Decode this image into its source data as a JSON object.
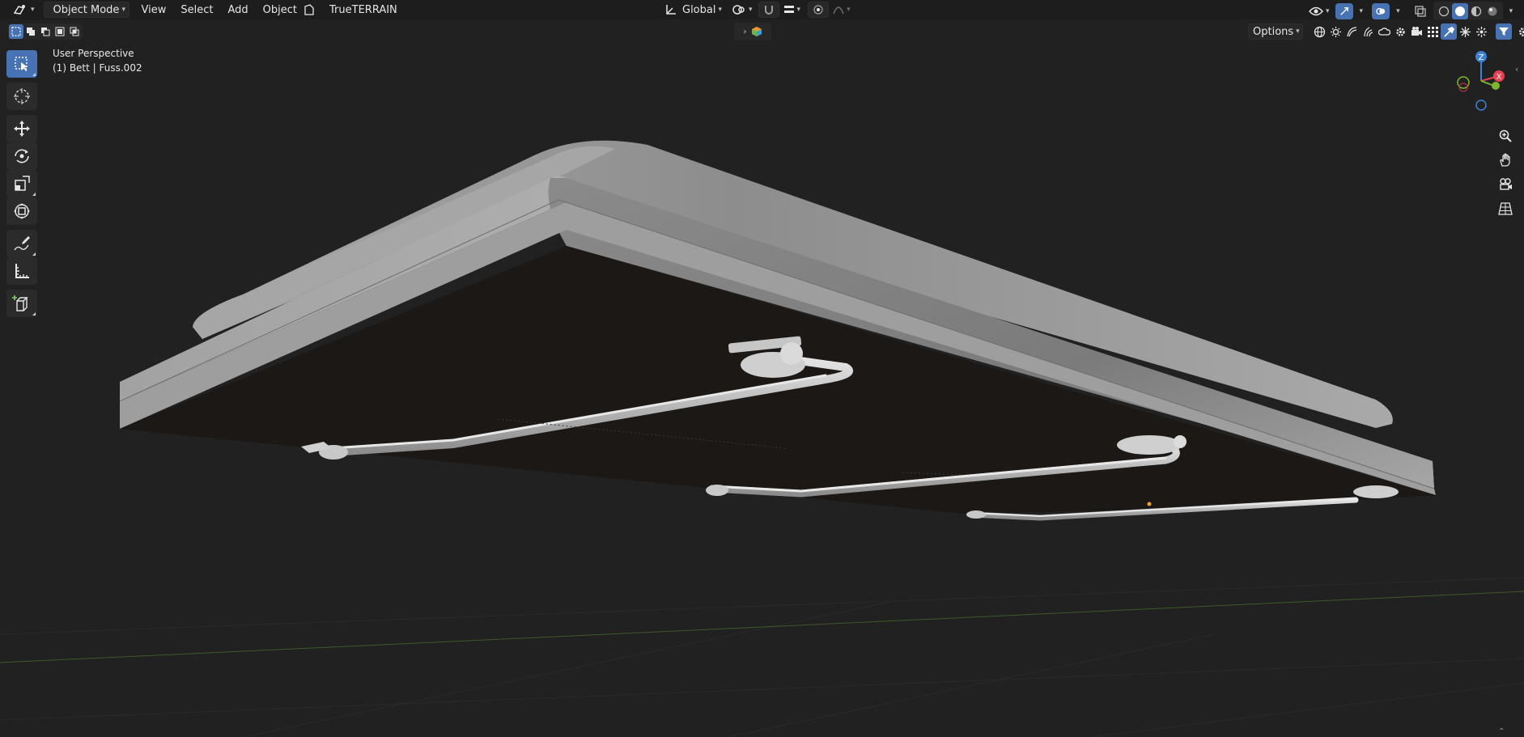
{
  "header": {
    "mode_label": "Object Mode",
    "menu": [
      "View",
      "Select",
      "Add",
      "Object"
    ],
    "addon_label": "TrueTERRAIN",
    "transform_orientation": "Global"
  },
  "toolrow": {
    "options_label": "Options"
  },
  "viewport": {
    "view_name": "User Perspective",
    "object_info": "(1) Bett | Fuss.002"
  },
  "gizmo": {
    "axes": [
      "Z",
      "X"
    ],
    "colors": {
      "x": "#e8404f",
      "y": "#7cb82f",
      "z": "#3b82d6"
    }
  },
  "tools": [
    "select-box",
    "cursor",
    "move",
    "rotate",
    "scale",
    "transform",
    "annotate",
    "measure",
    "add-cube"
  ],
  "colors": {
    "accent": "#4772b3",
    "header_bg": "#1d1d1d",
    "viewport_bg": "#212121"
  }
}
